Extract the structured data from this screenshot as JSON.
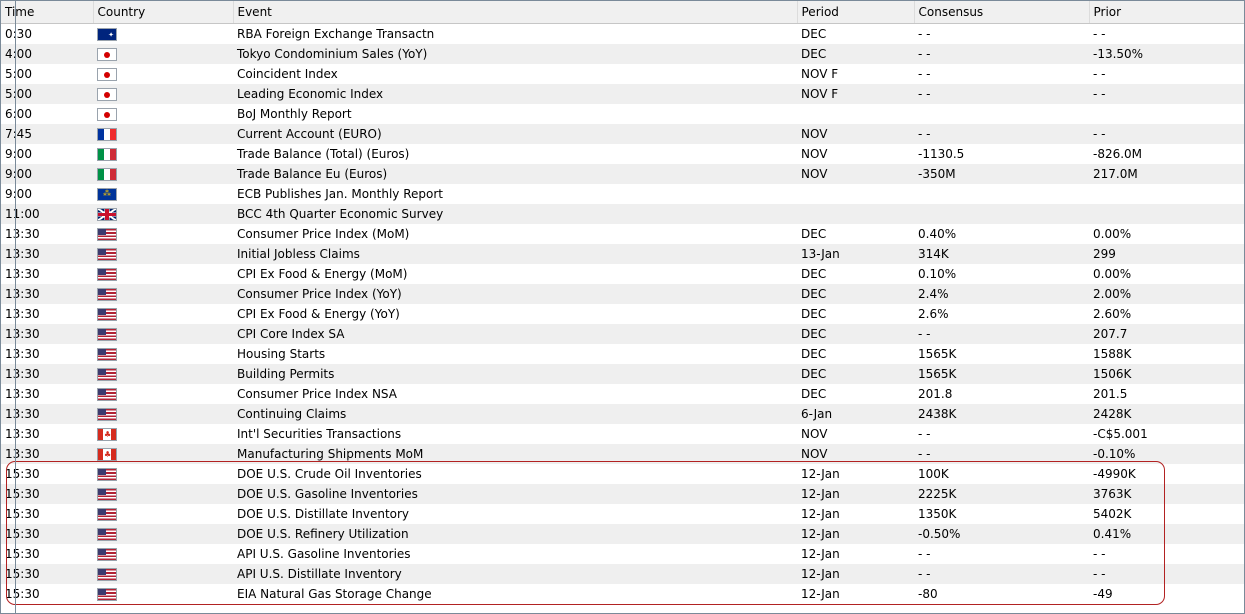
{
  "columns": {
    "time": "Time",
    "country": "Country",
    "event": "Event",
    "period": "Period",
    "consensus": "Consensus",
    "prior": "Prior"
  },
  "rows": [
    {
      "time": "0:30",
      "flag": "australia-flag-icon",
      "event": "RBA Foreign Exchange Transactn",
      "period": "DEC",
      "consensus": "- -",
      "prior": "- -"
    },
    {
      "time": "4:00",
      "flag": "japan-flag-icon",
      "event": "Tokyo Condominium Sales (YoY)",
      "period": "DEC",
      "consensus": "- -",
      "prior": "-13.50%"
    },
    {
      "time": "5:00",
      "flag": "japan-flag-icon",
      "event": "Coincident Index",
      "period": "NOV F",
      "consensus": "- -",
      "prior": "- -"
    },
    {
      "time": "5:00",
      "flag": "japan-flag-icon",
      "event": "Leading Economic Index",
      "period": "NOV F",
      "consensus": "- -",
      "prior": "- -"
    },
    {
      "time": "6:00",
      "flag": "japan-flag-icon",
      "event": "BoJ Monthly Report",
      "period": "",
      "consensus": "",
      "prior": ""
    },
    {
      "time": "7:45",
      "flag": "france-flag-icon",
      "event": "Current Account (EURO)",
      "period": "NOV",
      "consensus": "- -",
      "prior": "- -"
    },
    {
      "time": "9:00",
      "flag": "italy-flag-icon",
      "event": "Trade Balance (Total) (Euros)",
      "period": "NOV",
      "consensus": "-1130.5",
      "prior": "-826.0M"
    },
    {
      "time": "9:00",
      "flag": "italy-flag-icon",
      "event": "Trade Balance Eu (Euros)",
      "period": "NOV",
      "consensus": "-350M",
      "prior": "217.0M"
    },
    {
      "time": "9:00",
      "flag": "eu-flag-icon",
      "event": "ECB Publishes Jan. Monthly Report",
      "period": "",
      "consensus": "",
      "prior": ""
    },
    {
      "time": "11:00",
      "flag": "uk-flag-icon",
      "event": "BCC 4th Quarter Economic Survey",
      "period": "",
      "consensus": "",
      "prior": ""
    },
    {
      "time": "13:30",
      "flag": "us-flag-icon",
      "event": "Consumer Price Index (MoM)",
      "period": "DEC",
      "consensus": "0.40%",
      "prior": "0.00%"
    },
    {
      "time": "13:30",
      "flag": "us-flag-icon",
      "event": "Initial Jobless Claims",
      "period": "13-Jan",
      "consensus": "314K",
      "prior": "299"
    },
    {
      "time": "13:30",
      "flag": "us-flag-icon",
      "event": "CPI Ex Food & Energy (MoM)",
      "period": "DEC",
      "consensus": "0.10%",
      "prior": "0.00%"
    },
    {
      "time": "13:30",
      "flag": "us-flag-icon",
      "event": "Consumer Price Index (YoY)",
      "period": "DEC",
      "consensus": "2.4%",
      "prior": "2.00%"
    },
    {
      "time": "13:30",
      "flag": "us-flag-icon",
      "event": "CPI Ex Food & Energy (YoY)",
      "period": "DEC",
      "consensus": "2.6%",
      "prior": "2.60%"
    },
    {
      "time": "13:30",
      "flag": "us-flag-icon",
      "event": "CPI Core Index SA",
      "period": "DEC",
      "consensus": "- -",
      "prior": "207.7"
    },
    {
      "time": "13:30",
      "flag": "us-flag-icon",
      "event": "Housing Starts",
      "period": "DEC",
      "consensus": "1565K",
      "prior": "1588K"
    },
    {
      "time": "13:30",
      "flag": "us-flag-icon",
      "event": "Building Permits",
      "period": "DEC",
      "consensus": "1565K",
      "prior": "1506K"
    },
    {
      "time": "13:30",
      "flag": "us-flag-icon",
      "event": "Consumer Price Index NSA",
      "period": "DEC",
      "consensus": "201.8",
      "prior": "201.5"
    },
    {
      "time": "13:30",
      "flag": "us-flag-icon",
      "event": "Continuing Claims",
      "period": "6-Jan",
      "consensus": "2438K",
      "prior": "2428K"
    },
    {
      "time": "13:30",
      "flag": "canada-flag-icon",
      "event": "Int'l Securities Transactions",
      "period": "NOV",
      "consensus": "- -",
      "prior": "-C$5.001"
    },
    {
      "time": "13:30",
      "flag": "canada-flag-icon",
      "event": "Manufacturing Shipments MoM",
      "period": "NOV",
      "consensus": "- -",
      "prior": "-0.10%"
    },
    {
      "time": "15:30",
      "flag": "us-flag-icon",
      "event": "DOE U.S. Crude Oil Inventories",
      "period": "12-Jan",
      "consensus": "100K",
      "prior": "-4990K"
    },
    {
      "time": "15:30",
      "flag": "us-flag-icon",
      "event": "DOE U.S. Gasoline Inventories",
      "period": "12-Jan",
      "consensus": "2225K",
      "prior": "3763K"
    },
    {
      "time": "15:30",
      "flag": "us-flag-icon",
      "event": "DOE U.S. Distillate Inventory",
      "period": "12-Jan",
      "consensus": "1350K",
      "prior": "5402K"
    },
    {
      "time": "15:30",
      "flag": "us-flag-icon",
      "event": "DOE U.S. Refinery Utilization",
      "period": "12-Jan",
      "consensus": "-0.50%",
      "prior": "0.41%"
    },
    {
      "time": "15:30",
      "flag": "us-flag-icon",
      "event": "API U.S. Gasoline Inventories",
      "period": "12-Jan",
      "consensus": "- -",
      "prior": "- -"
    },
    {
      "time": "15:30",
      "flag": "us-flag-icon",
      "event": "API U.S. Distillate Inventory",
      "period": "12-Jan",
      "consensus": "- -",
      "prior": "- -"
    },
    {
      "time": "15:30",
      "flag": "us-flag-icon",
      "event": "EIA Natural Gas Storage Change",
      "period": "12-Jan",
      "consensus": "-80",
      "prior": "-49"
    }
  ],
  "colors": {
    "header_bg": "#f0f0f0",
    "row_alt_bg": "#efefef",
    "highlight_border": "#b22222"
  }
}
